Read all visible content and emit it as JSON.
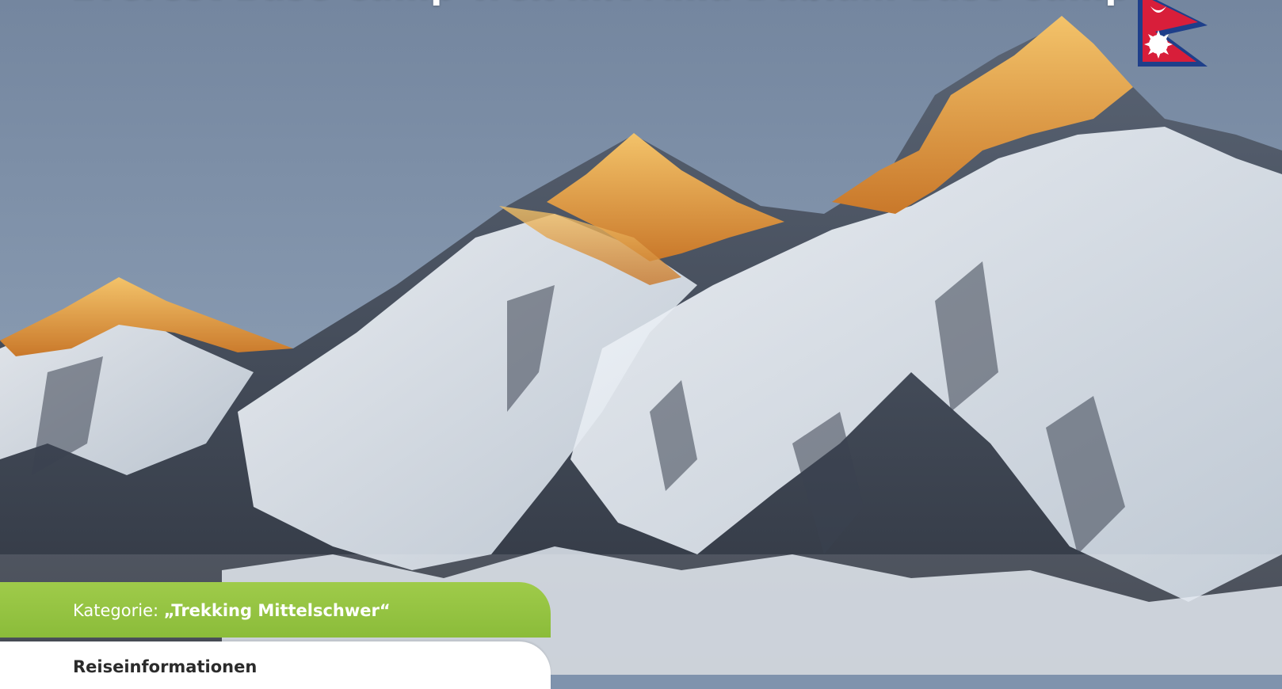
{
  "header": {
    "title": "Everest Base Camp Trek mit Ama Dablam Base Camp"
  },
  "flag": {
    "icon": "nepal-flag-icon",
    "colors": {
      "crimson": "#dc143c",
      "blue": "#003893",
      "white": "#ffffff"
    }
  },
  "category": {
    "label": "Kategorie:",
    "value": "„Trekking Mittelschwer“",
    "band_color": "#8bbc3a"
  },
  "info": {
    "heading": "Reiseinformationen"
  },
  "colors": {
    "sky_top": "#7a8ba6",
    "sky_horizon": "#9aa8b6",
    "alpenglow": "#e6a640",
    "snow": "#eef3f8",
    "rock": "#3e4552"
  }
}
